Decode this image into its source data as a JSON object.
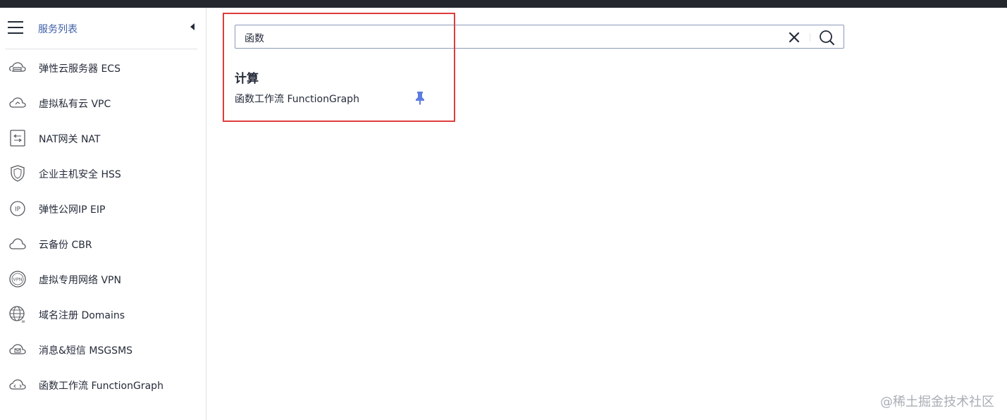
{
  "sidebar": {
    "title": "服务列表",
    "items": [
      {
        "label": "弹性云服务器 ECS",
        "icon": "cloud-server-icon"
      },
      {
        "label": "虚拟私有云 VPC",
        "icon": "vpc-cloud-icon"
      },
      {
        "label": "NAT网关 NAT",
        "icon": "nat-gateway-icon"
      },
      {
        "label": "企业主机安全 HSS",
        "icon": "shield-icon"
      },
      {
        "label": "弹性公网IP EIP",
        "icon": "ip-icon"
      },
      {
        "label": "云备份 CBR",
        "icon": "cloud-backup-icon"
      },
      {
        "label": "虚拟专用网络 VPN",
        "icon": "vpn-icon"
      },
      {
        "label": "域名注册 Domains",
        "icon": "globe-icon"
      },
      {
        "label": "消息&短信 MSGSMS",
        "icon": "message-icon"
      },
      {
        "label": "函数工作流 FunctionGraph",
        "icon": "function-graph-icon"
      }
    ]
  },
  "search": {
    "value": "函数"
  },
  "results": {
    "category": "计算",
    "items": [
      {
        "label": "函数工作流 FunctionGraph"
      }
    ]
  },
  "watermark": "@稀土掘金技术社区",
  "colors": {
    "accent": "#3e5ea6",
    "highlight_box": "#e03c3c",
    "pin": "#5e7ce0",
    "topbar": "#24272e"
  }
}
